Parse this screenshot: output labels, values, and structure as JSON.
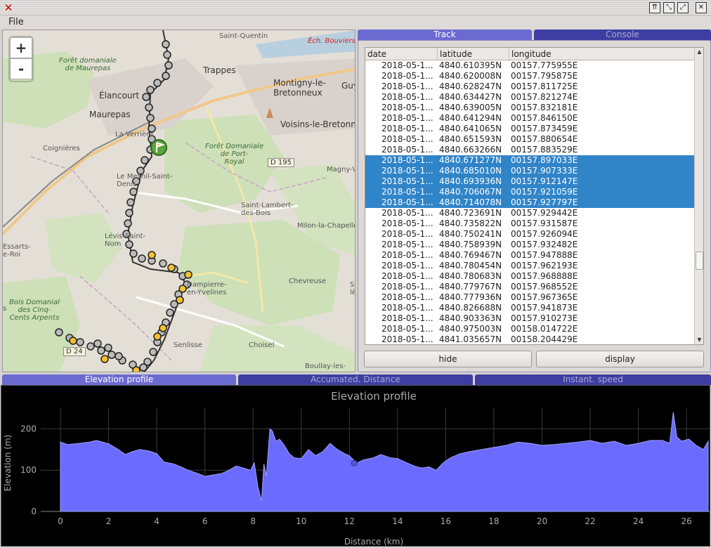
{
  "window": {
    "close_glyph": "✕",
    "buttons": [
      "⇈",
      "⤡",
      "⤢",
      "✕"
    ]
  },
  "menu": {
    "file": "File"
  },
  "map": {
    "zoom_in": "+",
    "zoom_out": "-",
    "labels": [
      {
        "id": "saint-quentin",
        "text": "Saint-Quentin",
        "cls": "small"
      },
      {
        "id": "foret-maurepas",
        "text": "Forêt domaniale\nde Maurepas",
        "cls": "italic"
      },
      {
        "id": "trappes",
        "text": "Trappes",
        "cls": ""
      },
      {
        "id": "ech-bouviers",
        "text": "Éch. Bouviers",
        "cls": "red"
      },
      {
        "id": "montigny",
        "text": "Montigny-le-\nBretonneux",
        "cls": ""
      },
      {
        "id": "guy",
        "text": "Guy",
        "cls": ""
      },
      {
        "id": "elancourt",
        "text": "Élancourt",
        "cls": ""
      },
      {
        "id": "maurepas",
        "text": "Maurepas",
        "cls": ""
      },
      {
        "id": "voisins",
        "text": "Voisins-le-Bretonn",
        "cls": ""
      },
      {
        "id": "la-verriere",
        "text": "La Verrière",
        "cls": "small"
      },
      {
        "id": "coignieres",
        "text": "Coignières",
        "cls": "small"
      },
      {
        "id": "foret-port-royal",
        "text": "Forêt Domaniale\nde Port-\nRoyal",
        "cls": "italic"
      },
      {
        "id": "d195",
        "text": "D 195",
        "cls": "boxed"
      },
      {
        "id": "magny",
        "text": "Magny-V",
        "cls": "small"
      },
      {
        "id": "le-mesnil",
        "text": "Le Mesnil-Saint-\nDenis",
        "cls": "small"
      },
      {
        "id": "saint-lambert",
        "text": "Saint-Lambert-\ndes-Bois",
        "cls": "small"
      },
      {
        "id": "milon",
        "text": "Milon-la-Chapelle",
        "cls": "small"
      },
      {
        "id": "essarts",
        "text": "Essarts-\ne-Roi",
        "cls": "small"
      },
      {
        "id": "levis",
        "text": "Lévis-Saint-\nNom",
        "cls": "small"
      },
      {
        "id": "dampierre",
        "text": "Dampierre-\nen-Yvelines",
        "cls": "small"
      },
      {
        "id": "chevreuse",
        "text": "Chevreuse",
        "cls": "small"
      },
      {
        "id": "sa-les",
        "text": "Sa\nlès",
        "cls": "small"
      },
      {
        "id": "bois-cinq-cents",
        "text": "Bois Domanial\ndes Cinq-\nCents Arpents",
        "cls": "italic"
      },
      {
        "id": "s-left",
        "text": "s",
        "cls": "small"
      },
      {
        "id": "d24",
        "text": "D 24",
        "cls": "boxed"
      },
      {
        "id": "senlisse",
        "text": "Senlisse",
        "cls": "small"
      },
      {
        "id": "choisel",
        "text": "Choisel",
        "cls": "small"
      },
      {
        "id": "boullay",
        "text": "Boullay-les-",
        "cls": "small"
      }
    ]
  },
  "track_panel": {
    "tabs": [
      "Track",
      "Console"
    ],
    "columns": [
      "date",
      "latitude",
      "longitude"
    ],
    "rows": [
      {
        "date": "2018-05-1...",
        "lat": "4840.610395N",
        "lon": "00157.775955E",
        "sel": false
      },
      {
        "date": "2018-05-1...",
        "lat": "4840.620008N",
        "lon": "00157.795875E",
        "sel": false
      },
      {
        "date": "2018-05-1...",
        "lat": "4840.628247N",
        "lon": "00157.811725E",
        "sel": false
      },
      {
        "date": "2018-05-1...",
        "lat": "4840.634427N",
        "lon": "00157.821274E",
        "sel": false
      },
      {
        "date": "2018-05-1...",
        "lat": "4840.639005N",
        "lon": "00157.832181E",
        "sel": false
      },
      {
        "date": "2018-05-1...",
        "lat": "4840.641294N",
        "lon": "00157.846150E",
        "sel": false
      },
      {
        "date": "2018-05-1...",
        "lat": "4840.641065N",
        "lon": "00157.873459E",
        "sel": false
      },
      {
        "date": "2018-05-1...",
        "lat": "4840.651593N",
        "lon": "00157.880654E",
        "sel": false
      },
      {
        "date": "2018-05-1...",
        "lat": "4840.663266N",
        "lon": "00157.883529E",
        "sel": false
      },
      {
        "date": "2018-05-1...",
        "lat": "4840.671277N",
        "lon": "00157.897033E",
        "sel": true
      },
      {
        "date": "2018-05-1...",
        "lat": "4840.685010N",
        "lon": "00157.907333E",
        "sel": true
      },
      {
        "date": "2018-05-1...",
        "lat": "4840.693936N",
        "lon": "00157.912147E",
        "sel": true
      },
      {
        "date": "2018-05-1...",
        "lat": "4840.706067N",
        "lon": "00157.921059E",
        "sel": true
      },
      {
        "date": "2018-05-1...",
        "lat": "4840.714078N",
        "lon": "00157.927797E",
        "sel": true
      },
      {
        "date": "2018-05-1...",
        "lat": "4840.723691N",
        "lon": "00157.929442E",
        "sel": false
      },
      {
        "date": "2018-05-1...",
        "lat": "4840.735822N",
        "lon": "00157.931587E",
        "sel": false
      },
      {
        "date": "2018-05-1...",
        "lat": "4840.750241N",
        "lon": "00157.926094E",
        "sel": false
      },
      {
        "date": "2018-05-1...",
        "lat": "4840.758939N",
        "lon": "00157.932482E",
        "sel": false
      },
      {
        "date": "2018-05-1...",
        "lat": "4840.769467N",
        "lon": "00157.947888E",
        "sel": false
      },
      {
        "date": "2018-05-1...",
        "lat": "4840.780454N",
        "lon": "00157.962193E",
        "sel": false
      },
      {
        "date": "2018-05-1...",
        "lat": "4840.780683N",
        "lon": "00157.968888E",
        "sel": false
      },
      {
        "date": "2018-05-1...",
        "lat": "4840.779767N",
        "lon": "00157.968552E",
        "sel": false
      },
      {
        "date": "2018-05-1...",
        "lat": "4840.777936N",
        "lon": "00157.967365E",
        "sel": false
      },
      {
        "date": "2018-05-1...",
        "lat": "4840.826688N",
        "lon": "00157.941873E",
        "sel": false
      },
      {
        "date": "2018-05-1...",
        "lat": "4840.903363N",
        "lon": "00157.910273E",
        "sel": false
      },
      {
        "date": "2018-05-1...",
        "lat": "4840.975003N",
        "lon": "00158.014722E",
        "sel": false
      },
      {
        "date": "2018-05-1...",
        "lat": "4841.035657N",
        "lon": "00158.204429E",
        "sel": false
      }
    ],
    "hide_label": "hide",
    "display_label": "display"
  },
  "bottom_tabs": [
    "Elevation profile",
    "Accumated. Distance",
    "Instant. speed"
  ],
  "colors": {
    "accent": "#6b6ad1",
    "tab_inactive": "#3e3ea2",
    "selection": "#3084c8",
    "profile_fill": "#6b6bff",
    "chart_bg": "#000000"
  },
  "chart_data": {
    "type": "area",
    "title": "Elevation profile",
    "xlabel": "Distance (km)",
    "ylabel": "Elevation (m)",
    "xlim": [
      0,
      26.9
    ],
    "ylim": [
      0,
      250
    ],
    "xticks": [
      0,
      2,
      4,
      6,
      8,
      10,
      12,
      14,
      16,
      18,
      20,
      22,
      24,
      26
    ],
    "yticks": [
      0,
      100,
      200
    ],
    "grid": true,
    "marker_x": 12.2,
    "marker_y": 117,
    "series": [
      {
        "x": [
          0,
          0.3,
          0.8,
          1.2,
          1.5,
          2.0,
          2.4,
          2.7,
          3.0,
          3.3,
          3.7,
          4.0,
          4.3,
          4.7,
          5.0,
          5.3,
          5.7,
          6.0,
          6.3,
          6.7,
          7.0,
          7.3,
          7.6,
          7.9,
          8.05,
          8.2,
          8.35,
          8.45,
          8.55,
          8.7,
          8.8,
          8.95,
          9.1,
          9.3,
          9.5,
          9.7,
          10.0,
          10.3,
          10.6,
          10.9,
          11.2,
          11.5,
          11.8,
          12.0,
          12.3,
          12.6,
          13.0,
          13.3,
          13.7,
          14.0,
          14.3,
          14.7,
          15.0,
          15.3,
          15.6,
          15.9,
          16.2,
          16.6,
          17.0,
          17.5,
          18.0,
          18.5,
          19.0,
          19.5,
          20.0,
          20.5,
          21.0,
          21.5,
          22.0,
          22.5,
          23.0,
          23.5,
          24.0,
          24.5,
          25.0,
          25.3,
          25.45,
          25.6,
          25.8,
          26.1,
          26.4,
          26.7,
          26.9
        ],
        "y": [
          168,
          162,
          165,
          168,
          172,
          164,
          150,
          138,
          145,
          150,
          146,
          140,
          120,
          115,
          108,
          100,
          92,
          85,
          88,
          92,
          100,
          110,
          105,
          100,
          118,
          60,
          25,
          115,
          85,
          200,
          195,
          170,
          175,
          160,
          140,
          130,
          128,
          150,
          135,
          145,
          165,
          150,
          140,
          135,
          117,
          125,
          130,
          138,
          130,
          128,
          120,
          110,
          105,
          108,
          100,
          118,
          130,
          140,
          145,
          150,
          155,
          160,
          168,
          165,
          160,
          162,
          165,
          168,
          172,
          165,
          170,
          160,
          165,
          172,
          172,
          165,
          240,
          180,
          170,
          175,
          160,
          150,
          170
        ]
      }
    ]
  }
}
